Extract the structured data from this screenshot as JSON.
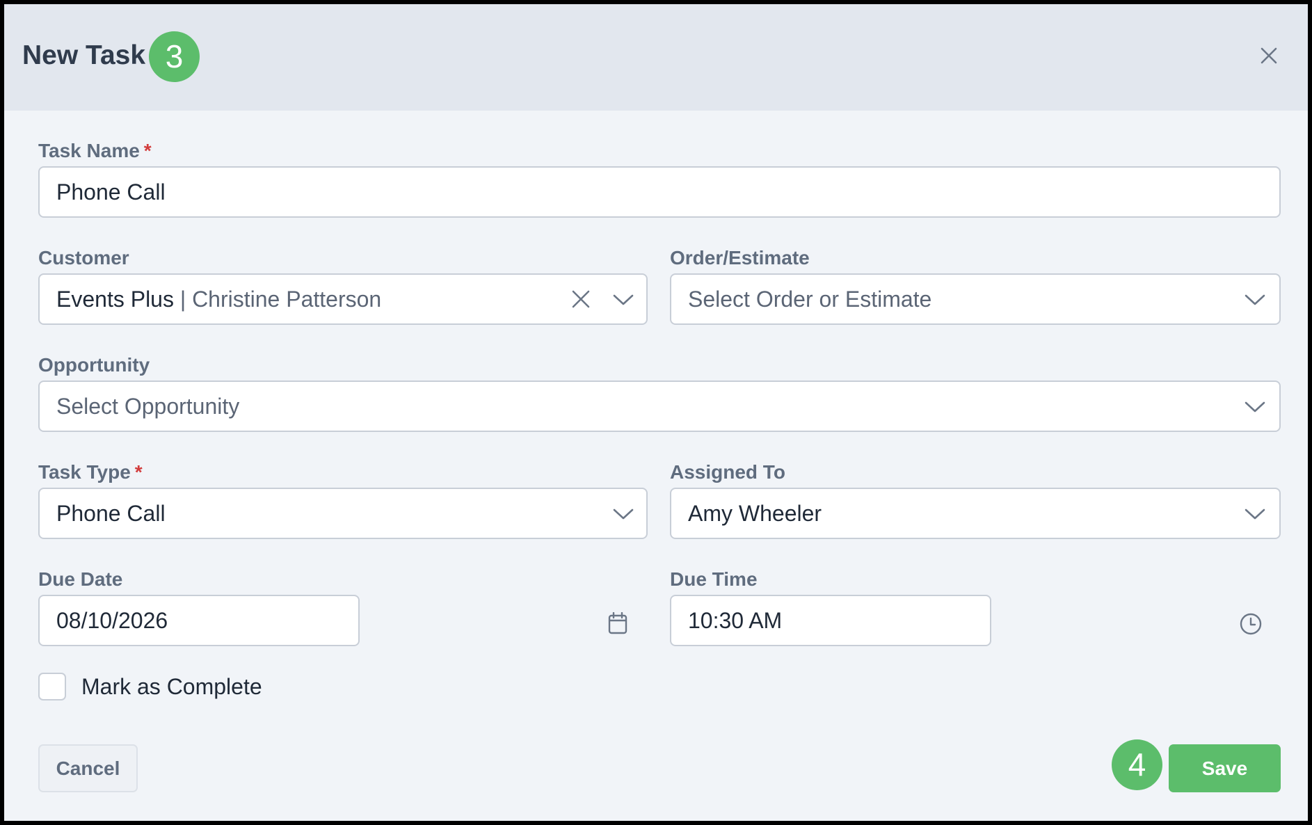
{
  "modal": {
    "title": "New Task",
    "title_step": "3",
    "save_step": "4"
  },
  "form": {
    "task_name": {
      "label": "Task Name",
      "required_mark": "*",
      "value": "Phone Call"
    },
    "customer": {
      "label": "Customer",
      "value_primary": "Events Plus",
      "value_separator": " | ",
      "value_secondary": "Christine Patterson"
    },
    "order_estimate": {
      "label": "Order/Estimate",
      "placeholder": "Select Order or Estimate"
    },
    "opportunity": {
      "label": "Opportunity",
      "placeholder": "Select Opportunity"
    },
    "task_type": {
      "label": "Task Type",
      "required_mark": "*",
      "value": "Phone Call"
    },
    "assigned_to": {
      "label": "Assigned To",
      "value": "Amy Wheeler"
    },
    "due_date": {
      "label": "Due Date",
      "value": "08/10/2026"
    },
    "due_time": {
      "label": "Due Time",
      "value": "10:30 AM"
    },
    "mark_complete": {
      "label": "Mark as Complete",
      "checked": false
    }
  },
  "footer": {
    "cancel_label": "Cancel",
    "save_label": "Save"
  },
  "colors": {
    "accent_green": "#5cbd6b",
    "required_red": "#d23c3c",
    "header_bg": "#e2e7ee",
    "body_bg": "#f1f4f8"
  },
  "icons": [
    "close-icon",
    "clear-icon",
    "chevron-down-icon",
    "calendar-icon",
    "clock-icon"
  ]
}
